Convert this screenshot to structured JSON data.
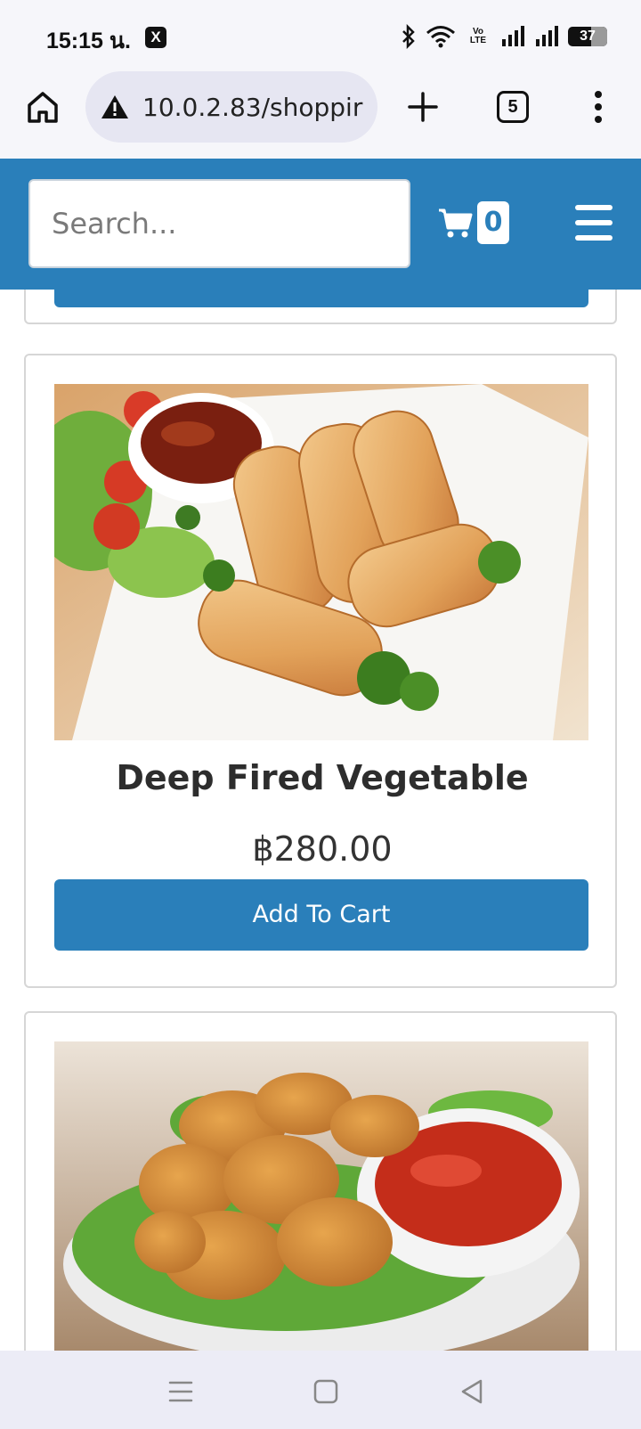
{
  "status_bar": {
    "time": "15:15 น.",
    "app_icon": "X",
    "icons": [
      "bluetooth-icon",
      "wifi-icon",
      "volte-icon",
      "signal-icon",
      "signal-icon"
    ],
    "volte": "Vo LTE",
    "battery": "37"
  },
  "browser": {
    "url": "10.0.2.83/shoppir",
    "tab_count": "5"
  },
  "header": {
    "search_placeholder": "Search...",
    "cart_count": "0",
    "brand_color": "#2a7fba"
  },
  "products": [
    {
      "title": "Deep Fired Vegetable",
      "price": "฿280.00",
      "button": "Add To Cart"
    }
  ]
}
